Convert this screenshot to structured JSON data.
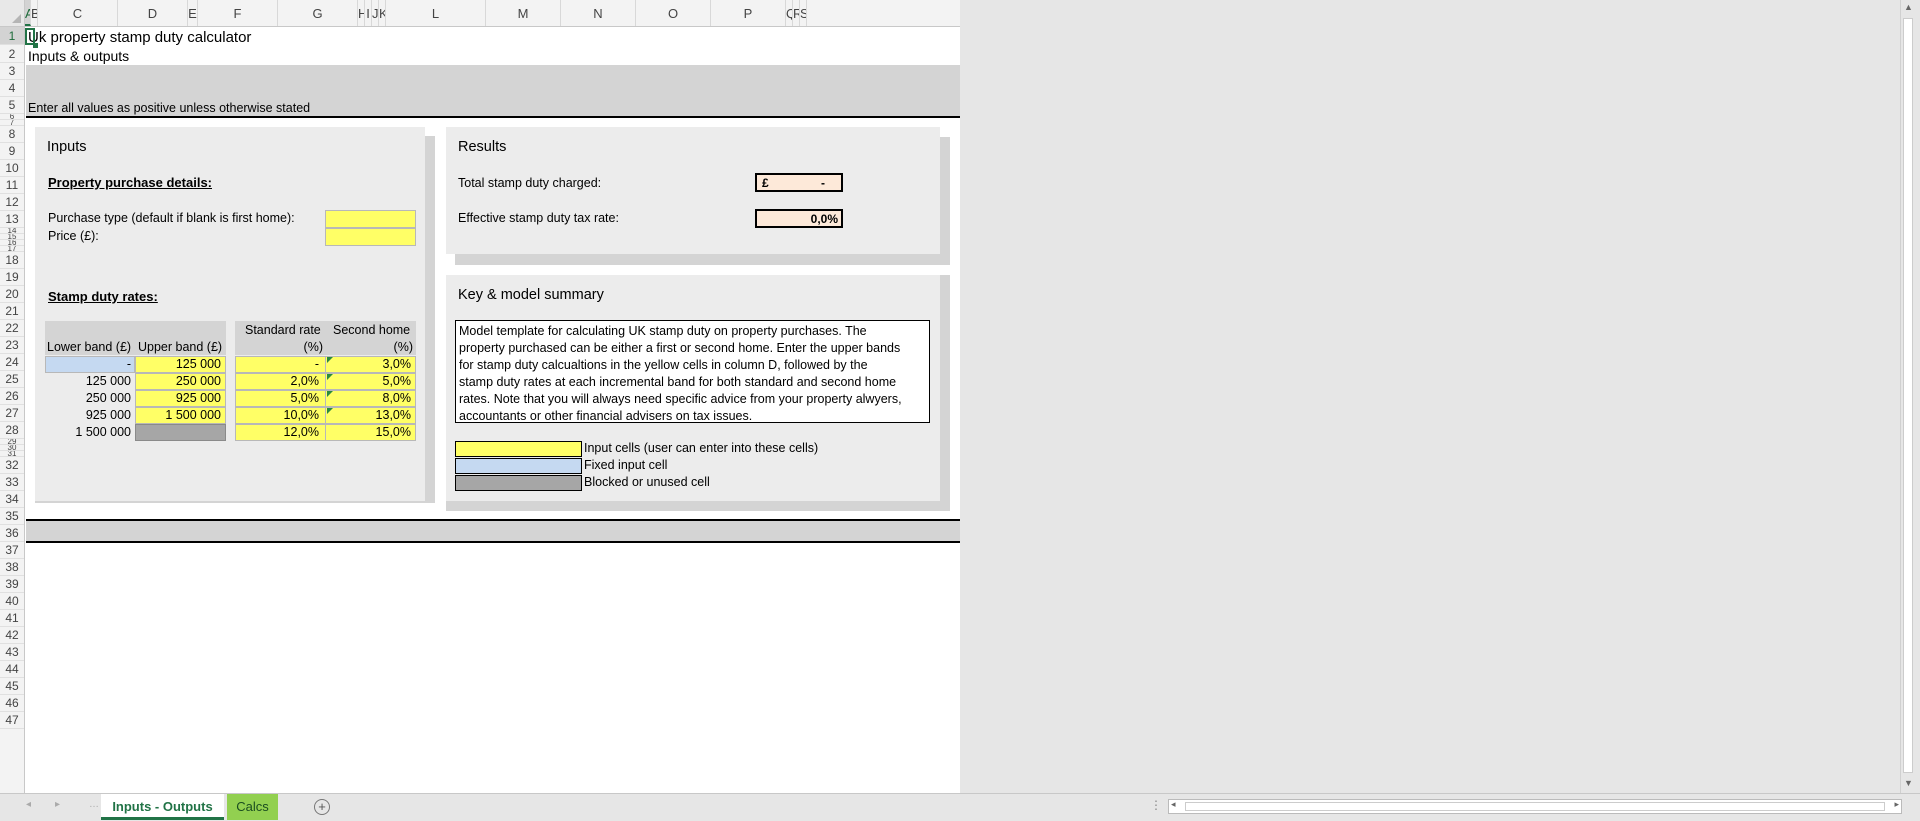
{
  "columns": [
    "A",
    "B",
    "C",
    "D",
    "E",
    "F",
    "G",
    "H",
    "I",
    "J",
    "K",
    "L",
    "M",
    "N",
    "O",
    "P",
    "Q",
    "R",
    "S"
  ],
  "rows": [
    "1",
    "2",
    "3",
    "4",
    "5",
    "6",
    "7",
    "8",
    "9",
    "10",
    "11",
    "12",
    "13",
    "14",
    "15",
    "16",
    "17",
    "18",
    "19",
    "20",
    "21",
    "22",
    "23",
    "24",
    "25",
    "26",
    "27",
    "28",
    "29",
    "30",
    "31",
    "32",
    "33",
    "34",
    "35",
    "36",
    "37",
    "38",
    "39",
    "40",
    "41",
    "42",
    "43",
    "44",
    "45",
    "46",
    "47"
  ],
  "sheet": {
    "title": "Uk property stamp duty calculator",
    "subtitle": "Inputs & outputs",
    "note": "Enter all values as positive unless otherwise stated"
  },
  "inputs": {
    "heading": "Inputs",
    "property_heading": "Property purchase details:",
    "purchase_type_label": "Purchase type (default if blank is first home):",
    "price_label": "Price (£):",
    "purchase_type_value": "",
    "price_value": "",
    "rates_heading": "Stamp duty rates:",
    "table_headers": {
      "lower": "Lower band (£)",
      "upper": "Upper band (£)",
      "standard_l1": "Standard rate",
      "standard_l2": "(%)",
      "second_l1": "Second home",
      "second_l2": "(%)"
    },
    "rates": [
      {
        "lower": "-",
        "upper": "125 000",
        "standard": "-",
        "second": "3,0%"
      },
      {
        "lower": "125 000",
        "upper": "250 000",
        "standard": "2,0%",
        "second": "5,0%"
      },
      {
        "lower": "250 000",
        "upper": "925 000",
        "standard": "5,0%",
        "second": "8,0%"
      },
      {
        "lower": "925 000",
        "upper": "1 500 000",
        "standard": "10,0%",
        "second": "13,0%"
      },
      {
        "lower": "1 500 000",
        "upper": "",
        "standard": "12,0%",
        "second": "15,0%"
      }
    ]
  },
  "results": {
    "heading": "Results",
    "total_label": "Total stamp duty charged:",
    "total_currency": "£",
    "total_value": "-",
    "rate_label": "Effective stamp duty tax rate:",
    "rate_value": "0,0%"
  },
  "key": {
    "heading": "Key & model summary",
    "summary_lines": [
      "Model template for calculating UK stamp duty on property purchases. The",
      "property purchased can be either a first or second home. Enter the upper bands",
      "for stamp duty calcualtions in the yellow cells in column D, followed by the",
      "stamp duty rates at each incremental band for both standard and second home",
      "rates. Note that you will always need specific advice from your property alwyers,",
      "accountants or other financial advisers on tax issues."
    ],
    "legend": [
      {
        "label": "Input cells (user can enter into these cells)",
        "color": "#ffff66"
      },
      {
        "label": "Fixed input cell",
        "color": "#c5d9f1"
      },
      {
        "label": "Blocked or unused cell",
        "color": "#a6a6a6"
      }
    ]
  },
  "tabs": [
    {
      "label": "Inputs - Outputs",
      "active": true
    },
    {
      "label": "Calcs",
      "active": false
    }
  ],
  "colors": {
    "accent": "#217346",
    "input": "#ffff66",
    "fixed": "#c5d9f1",
    "blocked": "#a6a6a6",
    "result": "#fde9d9"
  }
}
